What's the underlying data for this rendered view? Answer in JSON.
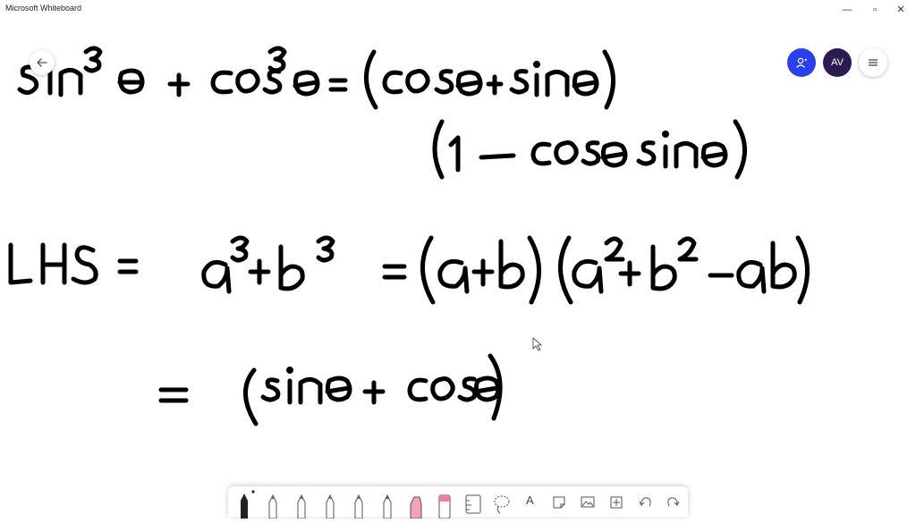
{
  "window": {
    "title": "Microsoft Whiteboard",
    "minimize_icon": "—",
    "restore_icon": "▫",
    "close_icon": "✕"
  },
  "header": {
    "back_icon": "arrow-left-icon",
    "avatar_initials": "AV",
    "colors": {
      "invite": "#2b3ff0",
      "avatar": "#2c1a52"
    }
  },
  "toolbar": {
    "text_tool_label": "A",
    "pen_colors": [
      "#111111",
      "#d63a3a",
      "#c2317a",
      "#2e9a3e",
      "#2f7ad6",
      "#1f5fa8"
    ]
  },
  "canvas": {
    "ink_lines": [
      "sin³θ + cos³θ = (cosθ + sinθ)",
      "(1 − cosθ sinθ)",
      "LHS = a³ + b³ = (a+b)(a² + b² − ab)",
      "= (sinθ + cosθ)"
    ]
  }
}
